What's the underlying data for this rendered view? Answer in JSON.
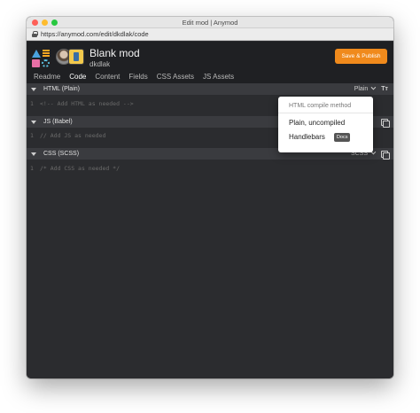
{
  "window": {
    "title": "Edit mod | Anymod"
  },
  "browser": {
    "url": "https://anymod.com/edit/dkdlak/code"
  },
  "header": {
    "mod_name": "Blank mod",
    "username": "dkdlak",
    "publish_label": "Save & Publish"
  },
  "tabs": [
    {
      "label": "Readme",
      "active": false
    },
    {
      "label": "Code",
      "active": true
    },
    {
      "label": "Content",
      "active": false
    },
    {
      "label": "Fields",
      "active": false
    },
    {
      "label": "CSS Assets",
      "active": false
    },
    {
      "label": "JS Assets",
      "active": false
    }
  ],
  "sections": {
    "html": {
      "title": "HTML (Plain)",
      "mode": "Plain",
      "line": "1",
      "code": "<!-- Add HTML as needed -->"
    },
    "js": {
      "title": "JS (Babel)",
      "line": "1",
      "code": "// Add JS as needed"
    },
    "css": {
      "title": "CSS (SCSS)",
      "mode": "SCSS",
      "line": "1",
      "code": "/* Add CSS as needed */"
    }
  },
  "dropdown": {
    "heading": "HTML compile method",
    "options": [
      {
        "label": "Plain, uncompiled"
      },
      {
        "label": "Handlebars",
        "badge": "Docs"
      }
    ]
  },
  "colors": {
    "accent": "#f08a1c",
    "background": "#2b2c2f",
    "header_bg": "#1f2023",
    "section_bar": "#3a3b3f"
  },
  "icons": [
    "lock-icon",
    "anymod-logo",
    "caret-down-icon",
    "chevron-down-icon",
    "text-format-icon",
    "copy-icon"
  ]
}
